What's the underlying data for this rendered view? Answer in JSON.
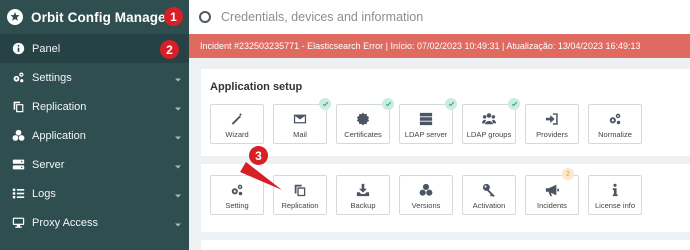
{
  "app": {
    "title": "Orbit Config Manager"
  },
  "search": {
    "placeholder": "Credentials, devices and information"
  },
  "alert": {
    "text": "Incident #232503235771 - Elasticsearch Error | Início: 07/02/2023 10:49:31 | Atualização: 13/04/2023 16:49:13"
  },
  "sidebar": {
    "items": [
      {
        "label": "Panel",
        "icon": "info-icon",
        "active": true
      },
      {
        "label": "Settings",
        "icon": "cogs-icon"
      },
      {
        "label": "Replication",
        "icon": "copy-icon"
      },
      {
        "label": "Application",
        "icon": "cubes-icon"
      },
      {
        "label": "Server",
        "icon": "server-icon"
      },
      {
        "label": "Logs",
        "icon": "list-icon"
      },
      {
        "label": "Proxy Access",
        "icon": "desktop-icon"
      }
    ]
  },
  "setup": {
    "title": "Application setup",
    "tiles": [
      {
        "label": "Wizard",
        "icon": "magic-wand-icon",
        "checked": false
      },
      {
        "label": "Mail",
        "icon": "envelope-icon",
        "checked": true
      },
      {
        "label": "Certificates",
        "icon": "certificate-icon",
        "checked": true
      },
      {
        "label": "LDAP server",
        "icon": "server-icon",
        "checked": true
      },
      {
        "label": "LDAP groups",
        "icon": "users-icon",
        "checked": true
      },
      {
        "label": "Providers",
        "icon": "sign-in-icon",
        "checked": false
      },
      {
        "label": "Normalize",
        "icon": "cogs-icon",
        "checked": false
      }
    ]
  },
  "tools": {
    "tiles": [
      {
        "label": "Setting",
        "icon": "cogs-icon"
      },
      {
        "label": "Replication",
        "icon": "copy-icon"
      },
      {
        "label": "Backup",
        "icon": "download-icon"
      },
      {
        "label": "Versions",
        "icon": "cubes-icon"
      },
      {
        "label": "Activation",
        "icon": "key-icon"
      },
      {
        "label": "Incidents",
        "icon": "bullhorn-icon",
        "badge": "2"
      },
      {
        "label": "License info",
        "icon": "info-icon"
      }
    ]
  },
  "callouts": [
    "1",
    "2",
    "3"
  ],
  "colors": {
    "sidebar": "#2f4e50",
    "alert": "#df6b60",
    "callout": "#d71f26",
    "check": "#2e9d7f",
    "badge": "#f19c2b"
  }
}
